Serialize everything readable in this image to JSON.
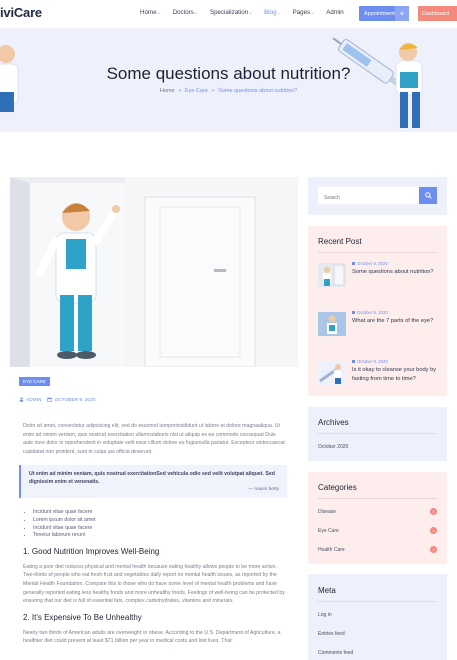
{
  "header": {
    "logo": "iviCare",
    "nav": [
      {
        "label": "Home",
        "chevron": true,
        "active": false
      },
      {
        "label": "Doctors",
        "chevron": true,
        "active": false
      },
      {
        "label": "Specialization",
        "chevron": true,
        "active": false
      },
      {
        "label": "Blog",
        "chevron": true,
        "active": true
      },
      {
        "label": "Pages",
        "chevron": true,
        "active": false
      },
      {
        "label": "Admin",
        "chevron": false,
        "active": false
      }
    ],
    "appointment_label": "Appointment",
    "plus_label": "+",
    "dashboard_label": "Dashboard"
  },
  "hero": {
    "title": "Some questions about nutrition?",
    "breadcrumb": [
      "Home",
      "Eye Care",
      "Some questions about nutrition?"
    ],
    "breadcrumb_sep": ">"
  },
  "post": {
    "tag": "EYE CARE",
    "author": "ADMIN",
    "date": "OCTOBER 9, 2020",
    "intro": "Dolor sit amet, consectetur adipisicing elit, sed do eiusmod temporincididunt ut labore et dolore magnaaliqua. Ut enim ad minim veniam, quis nostrud exercitation ullamcolaboris nisi ut aliquip ex ea commodo consequat Duis aute irure dolor in reprehenderit in voluptate velit esse cillum dolore eu fugiamulla pariatur. Excepteur sintoccaecat cupidatat non proident, sunt in culpa qui officia deserunt.",
    "quote_text": "Ut enim ad minim veniam, quis nostrud exercitationSed vehicula odio sed velit volutpat aliquet. Sed dignissim enim et venenatis.",
    "quote_author": "— maxin betty",
    "bullets": [
      "Incidunt vitae quae facere",
      "Lorem ipsum dolor sit amet",
      "Incidunt vitae quae facere",
      "Tenetur laborum rerum"
    ],
    "h1": "1. Good Nutrition Improves Well-Being",
    "p1": "Eating a poor diet reduces physical and mental health because eating healthy allows people to be more active. Two-thirds of people who eat fresh fruit and vegetables daily report no mental health issues, as reported by the Mental Health Foundation. Compare this to those who do have some level of mental health problems and have generally reported eating less healthy foods and more unhealthy foods. Feelings of well-being can be protected by ensuring that our diet is full of essential fats, complex carbohydrates, vitamins and minerals.",
    "h2": "2. It's Expensive To Be Unhealthy",
    "p2": "Nearly two thirds of American adults are overweight or obese. According to the U.S. Department of Agriculture, a healthier diet could prevent at least $71 billion per year in medical costs and lost lives. That"
  },
  "sidebar": {
    "search_placeholder": "Search",
    "recent_title": "Recent Post",
    "recent": [
      {
        "date": "October 9, 2020",
        "title": "Some questions about nutrition?"
      },
      {
        "date": "October 9, 2020",
        "title": "What are the 7 parts of the eye?"
      },
      {
        "date": "October 9, 2020",
        "title": "Is it okay to cleanse your body by fasting from time to time?"
      }
    ],
    "archives_title": "Archives",
    "archives": [
      "October 2020"
    ],
    "categories_title": "Categories",
    "categories": [
      {
        "label": "Disease",
        "count": "1"
      },
      {
        "label": "Eye Care",
        "count": "1"
      },
      {
        "label": "Health Care",
        "count": "1"
      }
    ],
    "meta_title": "Meta",
    "meta": [
      "Log in",
      "Entries feed",
      "Comments feed"
    ]
  },
  "colors": {
    "accent": "#6d8ef0",
    "coral": "#f4897e",
    "hero_bg": "#eef1fb",
    "pink_bg": "#fdeeed"
  }
}
